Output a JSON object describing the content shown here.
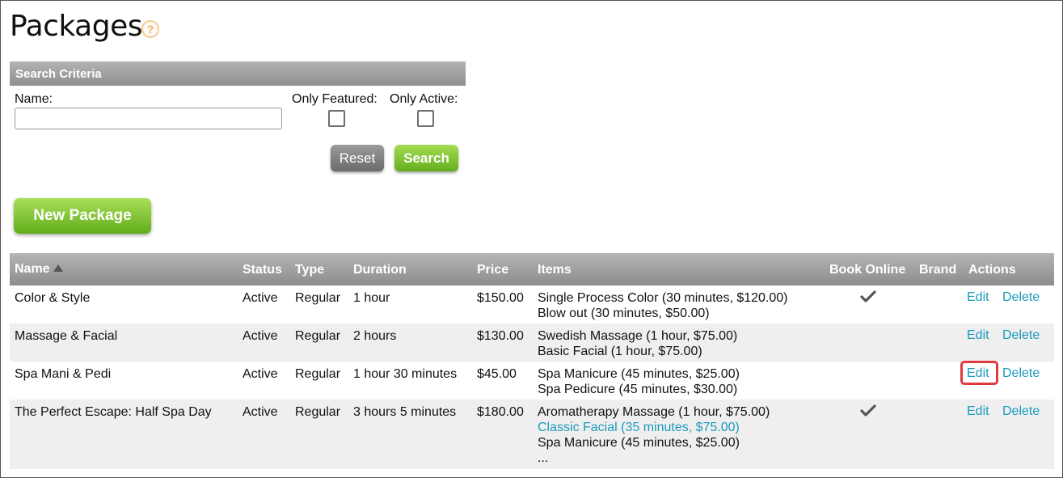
{
  "page": {
    "title": "Packages",
    "help_icon": "question-circle-icon"
  },
  "search": {
    "header": "Search Criteria",
    "name_label": "Name:",
    "name_value": "",
    "name_placeholder": "",
    "featured_label": "Only Featured:",
    "active_label": "Only Active:",
    "reset_label": "Reset",
    "search_label": "Search"
  },
  "toolbar": {
    "new_package_label": "New Package"
  },
  "table": {
    "columns": {
      "name": "Name",
      "status": "Status",
      "type": "Type",
      "duration": "Duration",
      "price": "Price",
      "items": "Items",
      "book_online": "Book Online",
      "brand": "Brand",
      "actions": "Actions"
    },
    "sort_icon": "sort-ascending-icon",
    "edit_label": "Edit",
    "delete_label": "Delete",
    "rows": [
      {
        "name": "Color & Style",
        "status": "Active",
        "type": "Regular",
        "duration": "1 hour",
        "price": "$150.00",
        "items": [
          "Single Process Color (30 minutes, $120.00)",
          "Blow out (30 minutes, $50.00)"
        ],
        "book_online": true
      },
      {
        "name": "Massage & Facial",
        "status": "Active",
        "type": "Regular",
        "duration": "2 hours",
        "price": "$130.00",
        "items": [
          "Swedish Massage (1 hour, $75.00)",
          "Basic Facial (1 hour, $75.00)"
        ],
        "book_online": false
      },
      {
        "name": "Spa Mani & Pedi",
        "status": "Active",
        "type": "Regular",
        "duration": "1 hour 30 minutes",
        "price": "$45.00",
        "items": [
          "Spa Manicure (45 minutes, $25.00)",
          "Spa Pedicure (45 minutes, $30.00)"
        ],
        "book_online": false
      },
      {
        "name": "The Perfect Escape: Half Spa Day",
        "status": "Active",
        "type": "Regular",
        "duration": "3 hours 5 minutes",
        "price": "$180.00",
        "items": [
          "Aromatherapy Massage (1 hour, $75.00)",
          "Classic Facial (35 minutes, $75.00)",
          "Spa Manicure (45 minutes, $25.00)",
          "..."
        ],
        "book_online": true
      }
    ]
  },
  "colors": {
    "link": "#1b9bbd",
    "accent_green": "#64ae1f",
    "highlight": "#e0393e"
  }
}
